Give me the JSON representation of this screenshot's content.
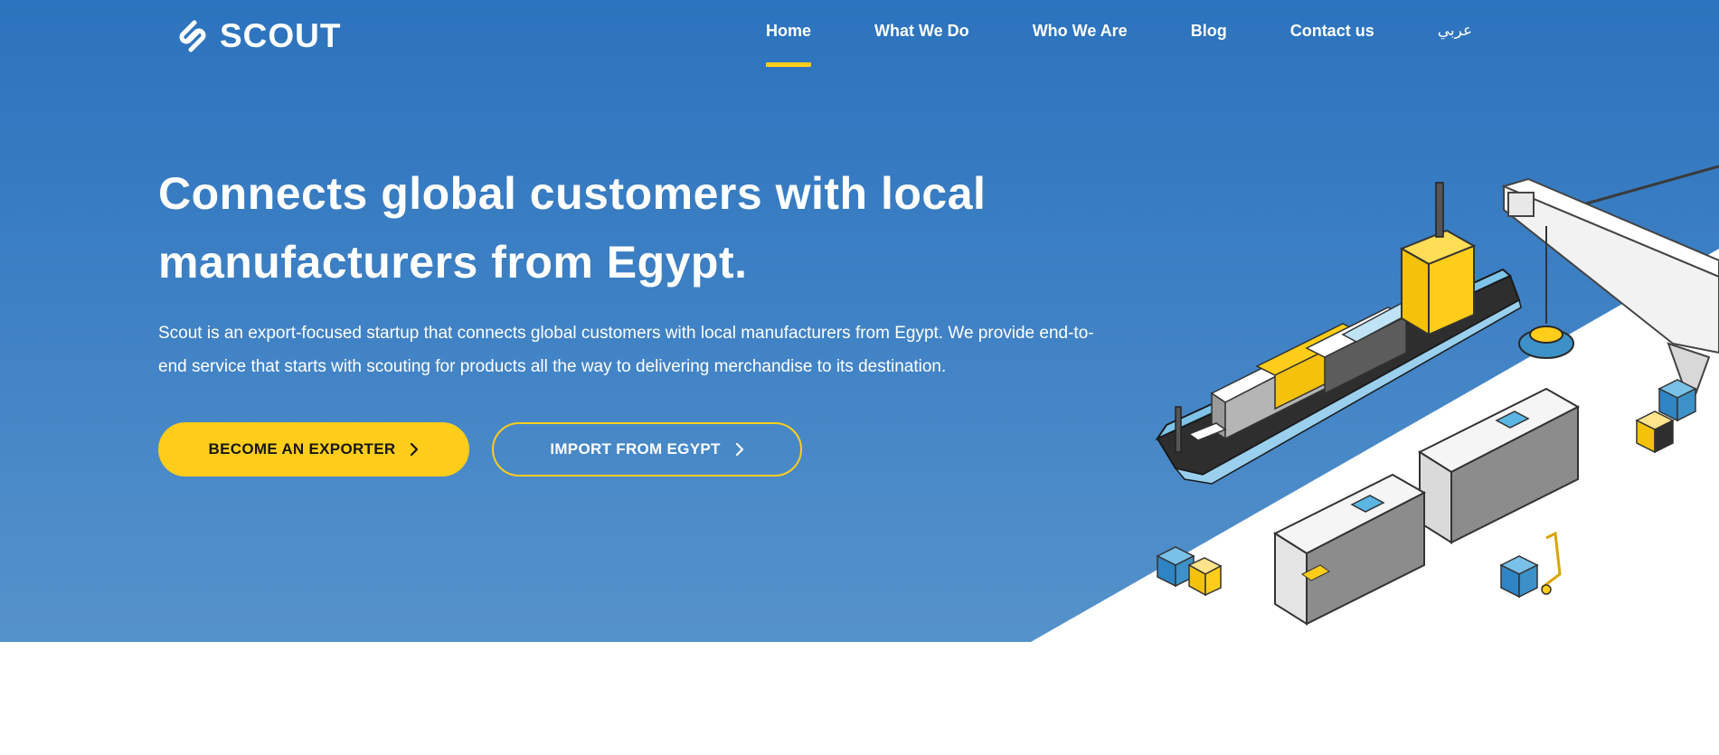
{
  "brand": {
    "name": "SCOUT"
  },
  "nav": {
    "items": [
      {
        "label": "Home",
        "active": true
      },
      {
        "label": "What We Do",
        "active": false
      },
      {
        "label": "Who We Are",
        "active": false
      },
      {
        "label": "Blog",
        "active": false
      },
      {
        "label": "Contact us",
        "active": false
      },
      {
        "label": "عربي",
        "active": false
      }
    ]
  },
  "hero": {
    "headline_line1": "Connects global customers with local",
    "headline_line2": "manufacturers from Egypt.",
    "description_line1": "Scout is an export-focused startup that connects global customers with local manufacturers from Egypt. We provide end-to-",
    "description_line2": "end service that starts with scouting for products all the way to delivering merchandise to its destination.",
    "primary_button": "BECOME AN EXPORTER",
    "secondary_button": "IMPORT FROM EGYPT"
  },
  "colors": {
    "hero_blue_top": "#2c73bd",
    "hero_blue_bottom": "#5592cb",
    "accent_yellow": "#ffcd1a",
    "text_white": "#ffffff",
    "button_text_dark": "#161616"
  },
  "icons": {
    "logo": "scout-logo-icon",
    "button_arrow": "chevron-right-icon",
    "illustration": "cargo-ship-port-illustration"
  }
}
